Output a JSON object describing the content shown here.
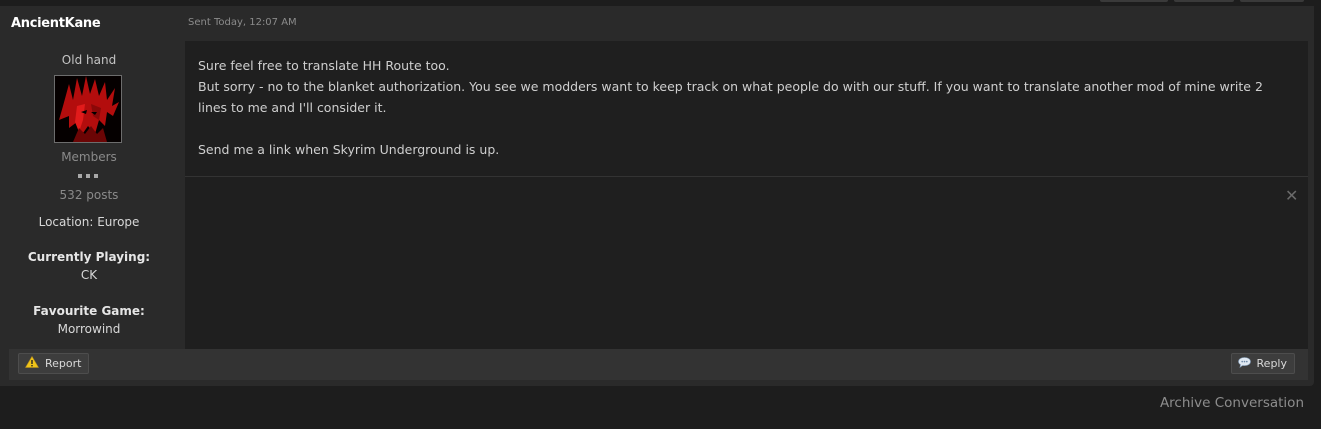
{
  "author": {
    "name": "AncientKane",
    "rank": "Old hand",
    "group": "Members",
    "post_count": "532 posts",
    "location": "Location: Europe",
    "fields": [
      {
        "label": "Currently Playing:",
        "value": "CK"
      },
      {
        "label": "Favourite Game:",
        "value": "Morrowind"
      }
    ]
  },
  "message": {
    "date": "Sent Today, 12:07 AM",
    "lines": [
      "Sure feel free to translate HH Route too.",
      "But sorry - no to the blanket authorization. You see we modders want to keep track on what people do with our stuff. If you want to translate another mod of mine write 2 lines to me and I'll consider it.",
      "Send me a link when Skyrim Underground is up."
    ]
  },
  "actions": {
    "report_label": "Report",
    "reply_label": "Reply",
    "close_glyph": "✕"
  },
  "footer": {
    "archive_label": "Archive Conversation"
  },
  "icons": {
    "report": "warning-icon",
    "reply": "speech-bubble-icon",
    "close": "close-icon"
  },
  "colors": {
    "page_bg": "#1d1d1d",
    "post_bg": "#2a2a2a",
    "message_bg": "#1f1f1f",
    "warning": "#f0c419"
  }
}
